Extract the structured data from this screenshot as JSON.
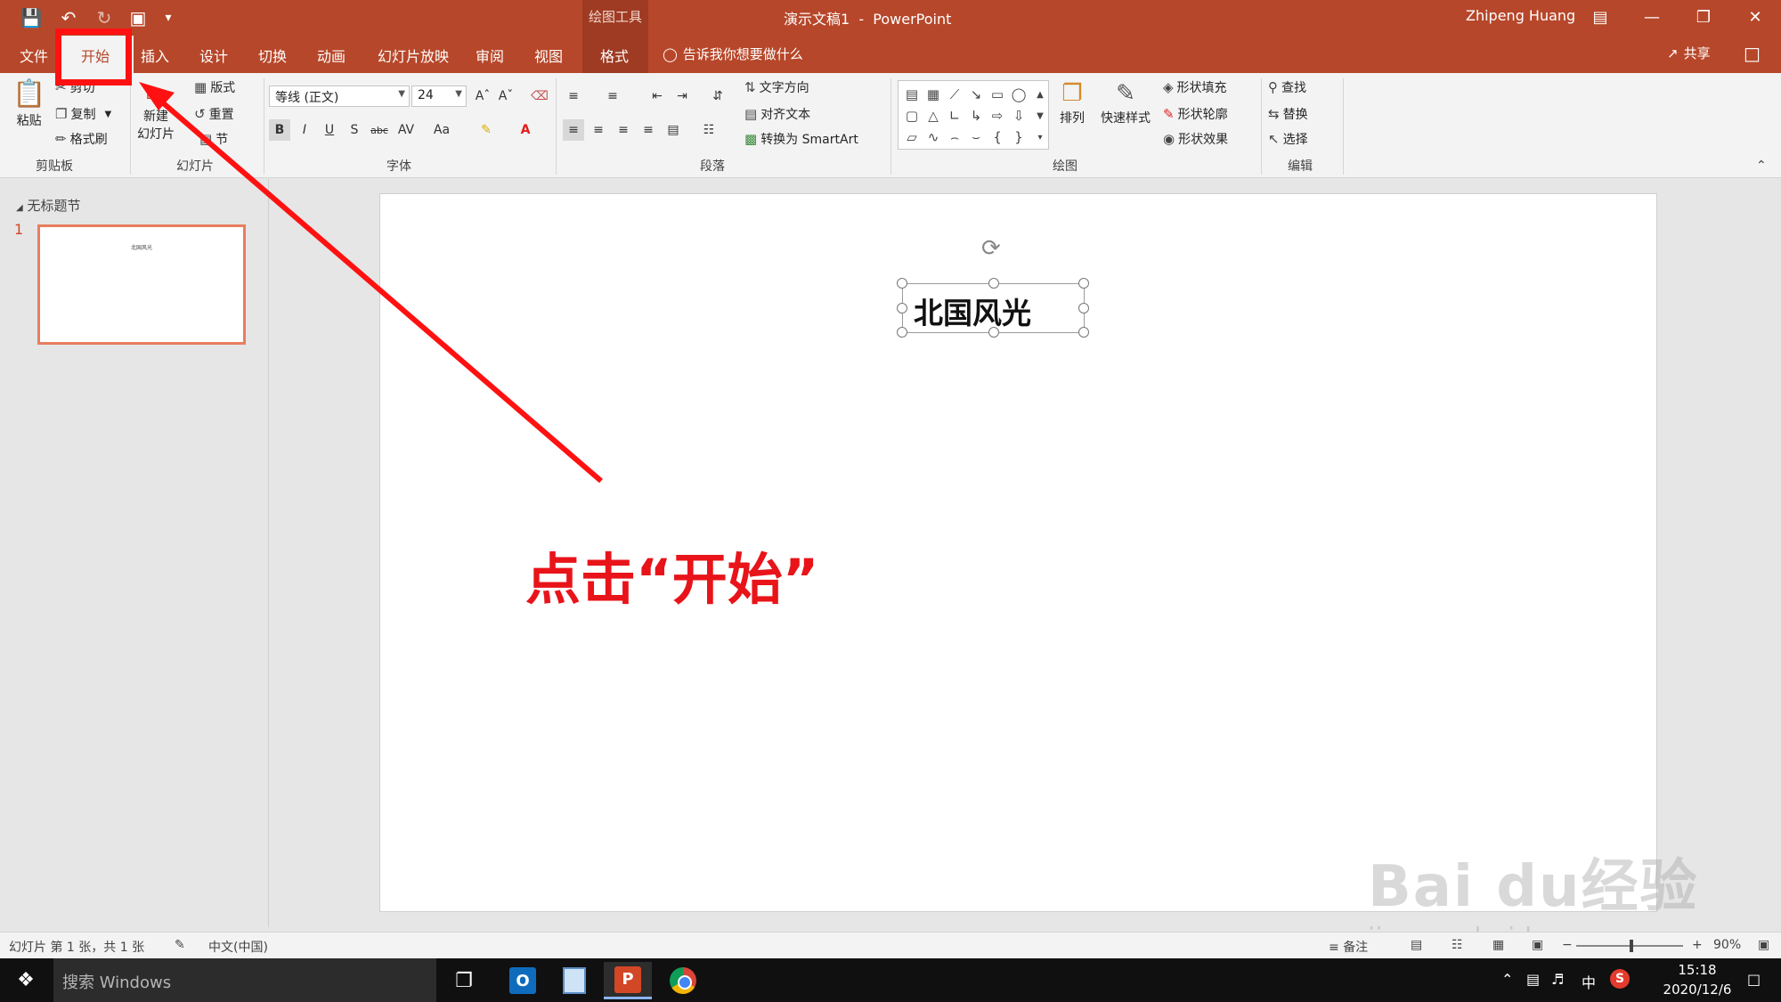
{
  "titlebar": {
    "context_tool": "绘图工具",
    "doc_title": "演示文稿1  -  PowerPoint",
    "user": "Zhipeng Huang"
  },
  "tabs": {
    "file": "文件",
    "home": "开始",
    "insert": "插入",
    "design": "设计",
    "transitions": "切换",
    "animations": "动画",
    "slideshow": "幻灯片放映",
    "review": "审阅",
    "view": "视图",
    "format": "格式",
    "tell_me": "告诉我你想要做什么",
    "share": "共享"
  },
  "ribbon": {
    "clipboard": {
      "paste": "粘贴",
      "cut": "剪切",
      "copy": "复制",
      "format_painter": "格式刷",
      "label": "剪贴板"
    },
    "slides": {
      "new_slide_line1": "新建",
      "new_slide_line2": "幻灯片",
      "layout": "版式",
      "reset": "重置",
      "section": "节",
      "label": "幻灯片"
    },
    "font": {
      "font_name": "等线 (正文)",
      "font_size": "24",
      "label": "字体"
    },
    "paragraph": {
      "text_direction": "文字方向",
      "align_text": "对齐文本",
      "convert_smartart": "转换为 SmartArt",
      "label": "段落"
    },
    "drawing": {
      "arrange": "排列",
      "quick_styles": "快速样式",
      "shape_fill": "形状填充",
      "shape_outline": "形状轮廓",
      "shape_effects": "形状效果",
      "label": "绘图"
    },
    "editing": {
      "find": "查找",
      "replace": "替换",
      "select": "选择",
      "label": "编辑"
    }
  },
  "thumbnails": {
    "section": "无标题节",
    "slide_number": "1",
    "thumb_text": "北国风光"
  },
  "slide": {
    "title": "北国风光"
  },
  "annotation": {
    "text": "点击“开始”",
    "color": "#e8141a"
  },
  "statusbar": {
    "slide_info": "幻灯片 第 1 张，共 1 张",
    "language": "中文(中国)",
    "notes": "备注",
    "zoom": "90%"
  },
  "taskbar": {
    "search_placeholder": "搜索 Windows",
    "ime": "中",
    "time": "15:18",
    "date": "2020/12/6"
  },
  "watermark": {
    "brand": "Bai du经验",
    "url": "jingyan.baidu.com"
  },
  "colors": {
    "accent": "#b7472a",
    "highlight": "#ff1111"
  }
}
